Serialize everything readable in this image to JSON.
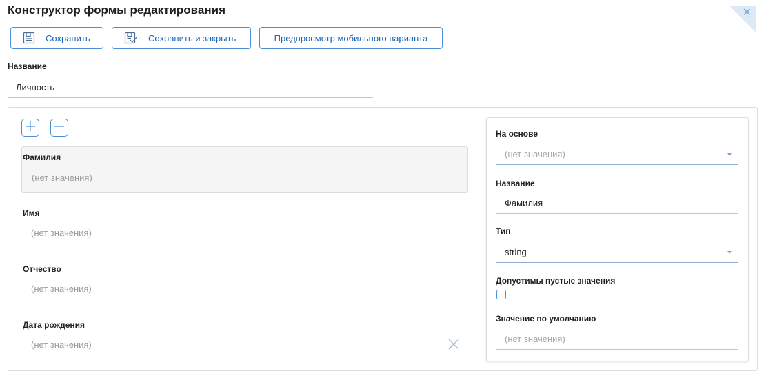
{
  "header": {
    "title": "Конструктор формы редактирования"
  },
  "toolbar": {
    "save_label": "Сохранить",
    "save_close_label": "Сохранить и закрыть",
    "preview_label": "Предпросмотр мобильного варианта"
  },
  "form_name": {
    "label": "Название",
    "value": "Личность"
  },
  "fields": [
    {
      "label": "Фамилия",
      "placeholder": "(нет значения)",
      "selected": true
    },
    {
      "label": "Имя",
      "placeholder": "(нет значения)"
    },
    {
      "label": "Отчество",
      "placeholder": "(нет значения)"
    },
    {
      "label": "Дата рождения",
      "placeholder": "(нет значения)",
      "clearable": true
    }
  ],
  "properties": {
    "based_on": {
      "label": "На основе",
      "placeholder": "(нет значения)"
    },
    "name": {
      "label": "Название",
      "value": "Фамилия"
    },
    "type": {
      "label": "Тип",
      "value": "string"
    },
    "allow_empty": {
      "label": "Допустимы пустые значения",
      "checked": false
    },
    "default_value": {
      "label": "Значение по умолчанию",
      "placeholder": "(нет значения)"
    }
  },
  "colors": {
    "accent": "#4a90d9",
    "accent_text": "#1b67b8",
    "placeholder": "#9a9a9a"
  },
  "icons": [
    "save-icon",
    "save-close-icon",
    "plus-icon",
    "minus-icon",
    "close-icon",
    "clear-icon",
    "chevron-down-icon"
  ]
}
